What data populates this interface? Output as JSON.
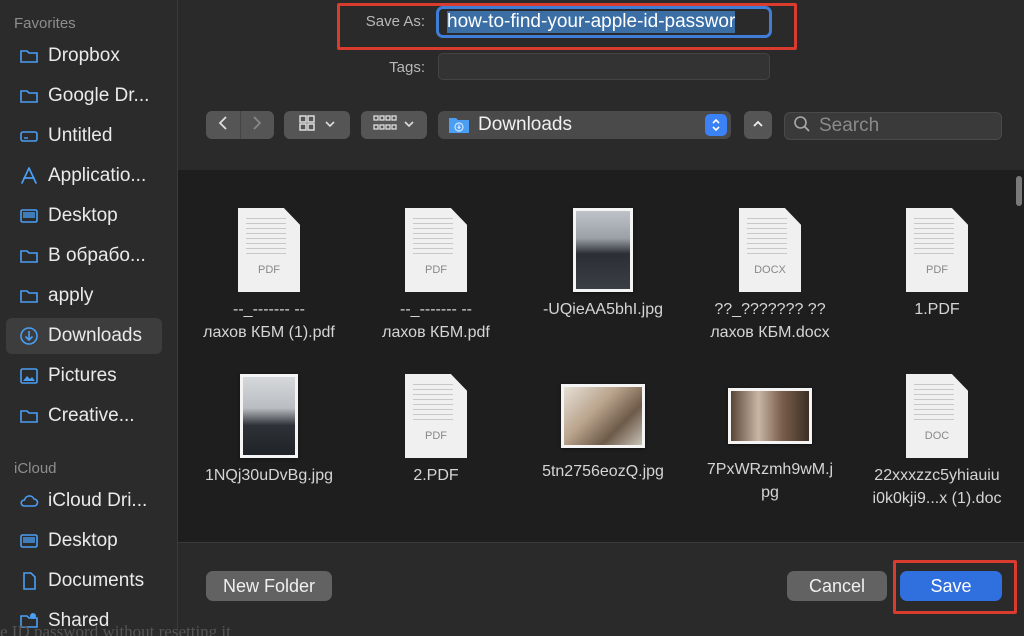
{
  "sidebar": {
    "favorites_label": "Favorites",
    "icloud_label": "iCloud",
    "favorites": [
      {
        "label": "Dropbox",
        "icon": "folder-icon"
      },
      {
        "label": "Google Dr...",
        "icon": "folder-icon"
      },
      {
        "label": "Untitled",
        "icon": "drive-icon"
      },
      {
        "label": "Applicatio...",
        "icon": "applications-icon"
      },
      {
        "label": "Desktop",
        "icon": "desktop-icon"
      },
      {
        "label": "В обрабо...",
        "icon": "folder-icon"
      },
      {
        "label": "apply",
        "icon": "folder-icon"
      },
      {
        "label": "Downloads",
        "icon": "downloads-icon",
        "active": true
      },
      {
        "label": "Pictures",
        "icon": "pictures-icon"
      },
      {
        "label": "Creative...",
        "icon": "folder-icon"
      }
    ],
    "icloud": [
      {
        "label": "iCloud Dri...",
        "icon": "cloud-icon"
      },
      {
        "label": "Desktop",
        "icon": "desktop-icon"
      },
      {
        "label": "Documents",
        "icon": "document-icon"
      },
      {
        "label": "Shared",
        "icon": "shared-folder-icon"
      }
    ]
  },
  "form": {
    "save_as_label": "Save As:",
    "save_as_value": "how-to-find-your-apple-id-passwor",
    "tags_label": "Tags:"
  },
  "toolbar": {
    "location": "Downloads",
    "search_placeholder": "Search"
  },
  "files": [
    {
      "name1": "--_------- --",
      "name2": "лахов КБМ (1).pdf",
      "kind": "doc",
      "ext": "PDF"
    },
    {
      "name1": "--_------- --",
      "name2": "лахов КБМ.pdf",
      "kind": "doc",
      "ext": "PDF"
    },
    {
      "name1": "-UQieAA5bhI.jpg",
      "name2": "",
      "kind": "photo-portrait"
    },
    {
      "name1": "??_??????? ??",
      "name2": "лахов КБМ.docx",
      "kind": "doc",
      "ext": "DOCX"
    },
    {
      "name1": "1.PDF",
      "name2": "",
      "kind": "doc",
      "ext": "PDF"
    },
    {
      "name1": "1NQj30uDvBg.jpg",
      "name2": "",
      "kind": "photo-portrait"
    },
    {
      "name1": "2.PDF",
      "name2": "",
      "kind": "doc",
      "ext": "PDF"
    },
    {
      "name1": "5tn2756eozQ.jpg",
      "name2": "",
      "kind": "photo-landscape"
    },
    {
      "name1": "7PxWRzmh9wM.j",
      "name2": "pg",
      "kind": "photo-landscape"
    },
    {
      "name1": "22xxxzzc5yhiauiu",
      "name2": "i0k0kji9...x (1).doc",
      "kind": "doc",
      "ext": "DOC"
    }
  ],
  "buttons": {
    "new_folder": "New Folder",
    "cancel": "Cancel",
    "save": "Save"
  },
  "background_text": "e ID password without resetting it"
}
